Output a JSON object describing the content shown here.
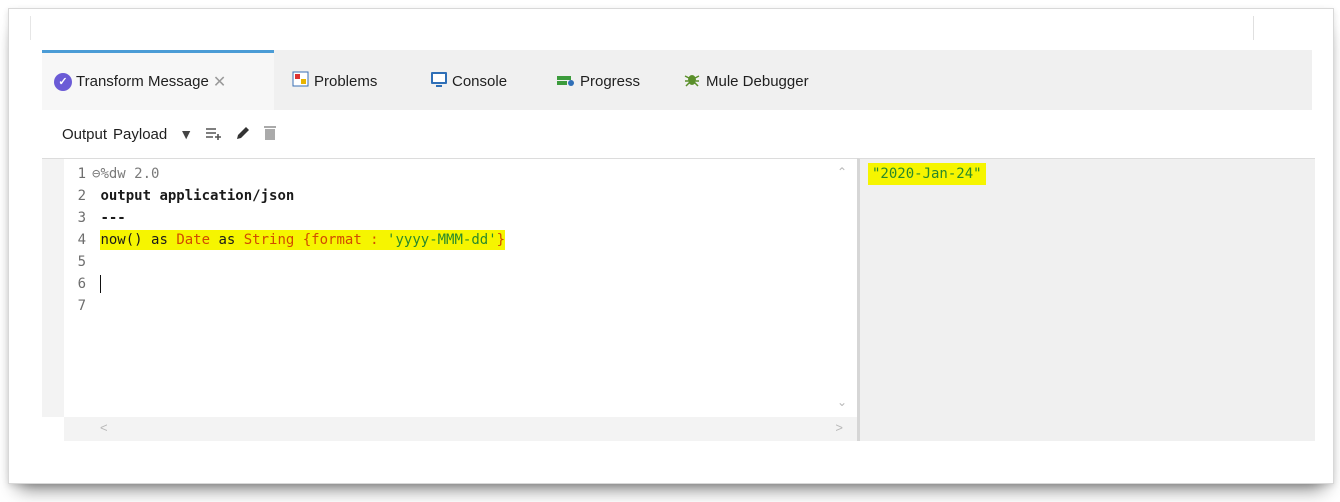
{
  "tabs": [
    {
      "label": "Transform Message",
      "icon": "dataweave-icon",
      "active": true,
      "closable": true
    },
    {
      "label": "Problems",
      "icon": "problems-icon"
    },
    {
      "label": "Console",
      "icon": "console-icon"
    },
    {
      "label": "Progress",
      "icon": "progress-icon"
    },
    {
      "label": "Mule Debugger",
      "icon": "debugger-icon"
    }
  ],
  "toolbar": {
    "output_label": "Output",
    "payload_label": "Payload",
    "icons": [
      "dropdown-icon",
      "add-output-icon",
      "edit-icon",
      "delete-icon"
    ]
  },
  "editor": {
    "line_numbers": [
      "1",
      "2",
      "3",
      "4",
      "5",
      "6",
      "7"
    ],
    "line1_fold": "⊖",
    "line1": "%dw 2.0",
    "line2": "output application/json",
    "line3": "---",
    "line4_a": "now()",
    "line4_b": " as ",
    "line4_c": "Date",
    "line4_d": " as ",
    "line4_e": "String",
    "line4_f": " {format : ",
    "line4_g": "'yyyy-MMM-dd'",
    "line4_h": "}"
  },
  "output": {
    "value": "\"2020-Jan-24\""
  },
  "colors": {
    "highlight": "#f6f500",
    "type": "#d14b00",
    "string": "#2a8a2a",
    "active_tab_border": "#4b9cd6"
  }
}
